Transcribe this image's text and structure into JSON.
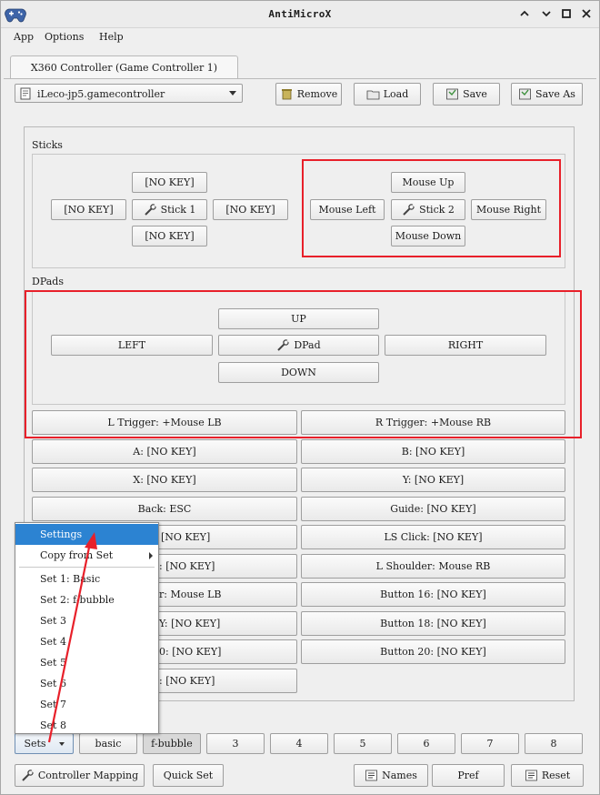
{
  "window": {
    "title": "AntiMicroX",
    "controls": [
      "chevron-up",
      "chevron-down",
      "maximize",
      "close"
    ]
  },
  "menubar": {
    "items": [
      "App",
      "Options",
      "Help"
    ]
  },
  "tab": {
    "label": "X360 Controller (Game Controller 1)"
  },
  "profile": {
    "selected": "iLeco-jp5.gamecontroller",
    "remove_label": "Remove",
    "load_label": "Load",
    "save_label": "Save",
    "save_as_label": "Save As"
  },
  "sticks": {
    "group_label": "Sticks",
    "stick1": {
      "up": "[NO KEY]",
      "left": "[NO KEY]",
      "center": "Stick 1",
      "right": "[NO KEY]",
      "down": "[NO KEY]"
    },
    "stick2": {
      "up": "Mouse Up",
      "left": "Mouse Left",
      "center": "Stick 2",
      "right": "Mouse Right",
      "down": "Mouse Down"
    }
  },
  "dpads": {
    "group_label": "DPads",
    "up": "UP",
    "left": "LEFT",
    "center": "DPad",
    "right": "RIGHT",
    "down": "DOWN"
  },
  "buttons": {
    "left": [
      "L Trigger: +Mouse LB",
      "A: [NO KEY]",
      "X: [NO KEY]",
      "Back: ESC",
      "[NO KEY]",
      ": [NO KEY]",
      "r: Mouse LB",
      "Y: [NO KEY]",
      "0: [NO KEY]",
      ": [NO KEY]"
    ],
    "right": [
      "R Trigger: +Mouse RB",
      "B: [NO KEY]",
      "Y: [NO KEY]",
      "Guide: [NO KEY]",
      "LS Click: [NO KEY]",
      "L Shoulder: Mouse RB",
      "Button 16: [NO KEY]",
      "Button 18: [NO KEY]",
      "Button 20: [NO KEY]"
    ]
  },
  "sets_menu": {
    "items": [
      "Settings",
      "Copy from Set",
      "Set 1: Basic",
      "Set 2: f-bubble",
      "Set 3",
      "Set 4",
      "Set 5",
      "Set 6",
      "Set 7",
      "Set 8"
    ]
  },
  "setbar": {
    "sets_label": "Sets",
    "set_buttons": [
      "basic",
      "f-bubble",
      "3",
      "4",
      "5",
      "6",
      "7",
      "8"
    ]
  },
  "bottombar": {
    "controller_mapping_label": "Controller Mapping",
    "quick_set_label": "Quick Set",
    "names_label": "Names",
    "pref_label": "Pref",
    "reset_label": "Reset"
  },
  "colors": {
    "annotation_red": "#e8202a",
    "selection_blue": "#2c83d2"
  }
}
